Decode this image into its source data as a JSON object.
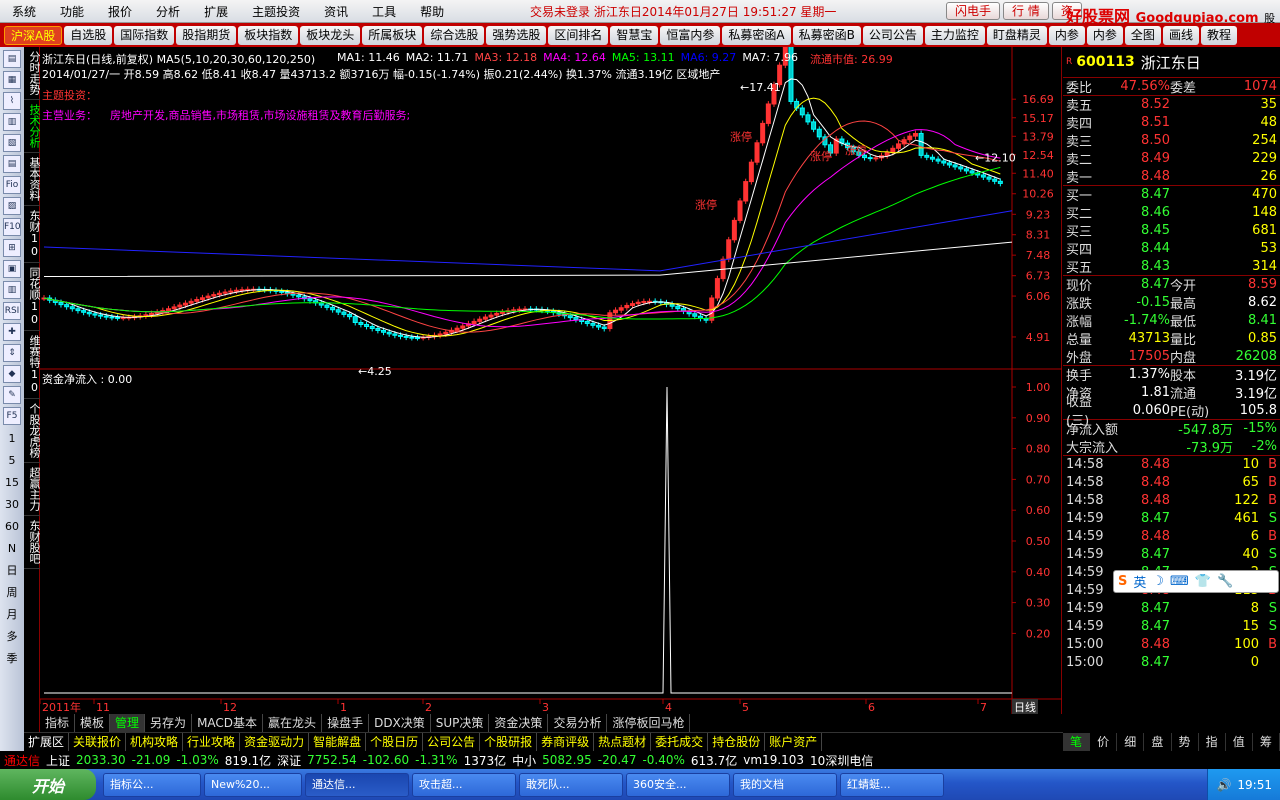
{
  "menu": [
    "系统",
    "功能",
    "报价",
    "分析",
    "扩展",
    "主题投资",
    "资讯",
    "工具",
    "帮助"
  ],
  "menu_center": "交易未登录   浙江东日2014年01月27日  19:51:27  星期一",
  "menu_buttons": [
    "闪电手",
    "行  情",
    "资"
  ],
  "logo": {
    "text": "好股票网",
    "url": "Goodgupiao.com",
    "sub": "股票软件公式"
  },
  "tabs": [
    "沪深A股",
    "自选股",
    "国际指数",
    "股指期货",
    "板块指数",
    "板块龙头",
    "所属板块",
    "综合选股",
    "强势选股",
    "区间排名",
    "智慧宝",
    "恒富内参",
    "私募密函A",
    "私募密函B",
    "公司公告",
    "主力监控",
    "盯盘精灵",
    "内参",
    "内参",
    "全图",
    "画线",
    "教程"
  ],
  "side_tabs": [
    "分时走势",
    "技术分析",
    "基本资料",
    "东财10",
    "同花顺10",
    "维赛特10",
    "个股龙虎榜",
    "超赢主力",
    "东财股吧"
  ],
  "side_nums": [
    "1",
    "5",
    "15",
    "30",
    "60",
    "N",
    "日",
    "周",
    "月",
    "多",
    "季"
  ],
  "chart": {
    "title_line": "浙江东日(日线,前复权) MA5(5,10,20,30,60,120,250)",
    "ma_labels": [
      {
        "t": "MA1: 11.46",
        "c": "#fff"
      },
      {
        "t": "MA2: 11.71",
        "c": "#fff"
      },
      {
        "t": "MA3: 12.18",
        "c": "#f44"
      },
      {
        "t": "MA4: 12.64",
        "c": "#f0f"
      },
      {
        "t": "MA5: 13.11",
        "c": "#0f0"
      },
      {
        "t": "MA6: 9.27",
        "c": "#00f"
      },
      {
        "t": "MA7: 7.96",
        "c": "#fff"
      }
    ],
    "market_cap": "流通市值: 26.99",
    "info_line": "2014/01/27/一 开8.59 高8.62 低8.41 收8.47 量43713.2 额3716万 幅-0.15(-1.74%) 振0.21(2.44%) 换1.37% 流通3.19亿 区域地产",
    "theme_label": "主题投资：",
    "business_label": "主营业务：",
    "business_text": "房地产开发,商品销售,市场租赁,市场设施租赁及教育后勤服务;",
    "price_axis": [
      "16.69",
      "15.17",
      "13.79",
      "12.54",
      "11.40",
      "10.26",
      "9.23",
      "8.31",
      "7.48",
      "6.73",
      "6.06",
      "4.91"
    ],
    "annotations": [
      {
        "t": "17.41"
      },
      {
        "t": "4.25"
      },
      {
        "t": "12.10"
      }
    ],
    "zt_label": "涨停",
    "flow_title": "资金净流入 : 0.00",
    "flow_axis": [
      "1.00",
      "0.90",
      "0.80",
      "0.70",
      "0.60",
      "0.50",
      "0.40",
      "0.30",
      "0.20"
    ],
    "x_labels": [
      "2011年",
      "11",
      "12",
      "1",
      "2",
      "3",
      "4",
      "5",
      "6",
      "7"
    ],
    "period": "日线"
  },
  "chart_data": {
    "type": "candlestick",
    "series": [
      {
        "name": "资金净流入",
        "peak": 1.0,
        "baseline": 0.0
      }
    ],
    "ylim": [
      4.25,
      17.41
    ]
  },
  "ind_tabs": [
    "指标",
    "模板",
    "管理",
    "另存为",
    "MACD基本",
    "赢在龙头",
    "操盘手",
    "DDX决策",
    "SUP决策",
    "资金决策",
    "交易分析",
    "涨停板回马枪"
  ],
  "ext_tabs": [
    "扩展区",
    "关联报价",
    "机构攻略",
    "行业攻略",
    "资金驱动力",
    "智能解盘",
    "个股日历",
    "公司公告",
    "个股研报",
    "券商评级",
    "热点题材",
    "委托成交",
    "持仓股份",
    "账户资产"
  ],
  "quote": {
    "code": "600113",
    "name": "浙江东日",
    "weibi": {
      "l": "委比",
      "v": "47.56%",
      "l2": "委差",
      "v2": "1074"
    },
    "asks": [
      {
        "l": "卖五",
        "p": "8.52",
        "v": "35"
      },
      {
        "l": "卖四",
        "p": "8.51",
        "v": "48"
      },
      {
        "l": "卖三",
        "p": "8.50",
        "v": "254"
      },
      {
        "l": "卖二",
        "p": "8.49",
        "v": "229"
      },
      {
        "l": "卖一",
        "p": "8.48",
        "v": "26"
      }
    ],
    "bids": [
      {
        "l": "买一",
        "p": "8.47",
        "v": "470"
      },
      {
        "l": "买二",
        "p": "8.46",
        "v": "148"
      },
      {
        "l": "买三",
        "p": "8.45",
        "v": "681"
      },
      {
        "l": "买四",
        "p": "8.44",
        "v": "53"
      },
      {
        "l": "买五",
        "p": "8.43",
        "v": "314"
      }
    ],
    "stats": [
      {
        "a": "现价",
        "b": "8.47",
        "c": "今开",
        "d": "8.59",
        "bc": "green",
        "dc": "red"
      },
      {
        "a": "涨跌",
        "b": "-0.15",
        "c": "最高",
        "d": "8.62",
        "bc": "green",
        "dc": "white"
      },
      {
        "a": "涨幅",
        "b": "-1.74%",
        "c": "最低",
        "d": "8.41",
        "bc": "green",
        "dc": "green"
      },
      {
        "a": "总量",
        "b": "43713",
        "c": "量比",
        "d": "0.85",
        "bc": "yellow",
        "dc": "yellow"
      },
      {
        "a": "外盘",
        "b": "17505",
        "c": "内盘",
        "d": "26208",
        "bc": "red",
        "dc": "green"
      },
      {
        "a": "换手",
        "b": "1.37%",
        "c": "股本",
        "d": "3.19亿",
        "bc": "white",
        "dc": "white"
      },
      {
        "a": "净资",
        "b": "1.81",
        "c": "流通",
        "d": "3.19亿",
        "bc": "white",
        "dc": "white"
      },
      {
        "a": "收益(三)",
        "b": "0.060",
        "c": "PE(动)",
        "d": "105.8",
        "bc": "white",
        "dc": "white"
      }
    ],
    "flows": [
      {
        "a": "净流入额",
        "b": "-547.8万",
        "c": "-15%"
      },
      {
        "a": "大宗流入",
        "b": "-73.9万",
        "c": "-2%"
      }
    ],
    "ticks": [
      {
        "t": "14:58",
        "p": "8.48",
        "v": "10",
        "s": "B"
      },
      {
        "t": "14:58",
        "p": "8.48",
        "v": "65",
        "s": "B"
      },
      {
        "t": "14:58",
        "p": "8.48",
        "v": "122",
        "s": "B"
      },
      {
        "t": "14:59",
        "p": "8.47",
        "v": "461",
        "s": "S"
      },
      {
        "t": "14:59",
        "p": "8.48",
        "v": "6",
        "s": "B"
      },
      {
        "t": "14:59",
        "p": "8.47",
        "v": "40",
        "s": "S"
      },
      {
        "t": "14:59",
        "p": "8.47",
        "v": "2",
        "s": "S"
      },
      {
        "t": "14:59",
        "p": "8.48",
        "v": "115",
        "s": "B"
      },
      {
        "t": "14:59",
        "p": "8.47",
        "v": "8",
        "s": "S"
      },
      {
        "t": "14:59",
        "p": "8.47",
        "v": "15",
        "s": "S"
      },
      {
        "t": "15:00",
        "p": "8.48",
        "v": "100",
        "s": "B"
      },
      {
        "t": "15:00",
        "p": "8.47",
        "v": "0",
        "s": ""
      }
    ],
    "tabs": [
      "笔",
      "价",
      "细",
      "盘",
      "势",
      "指",
      "值",
      "筹"
    ]
  },
  "status": [
    {
      "t": "通达信",
      "c": "#f00"
    },
    {
      "t": "上证",
      "c": "#fff"
    },
    {
      "t": "2033.30",
      "c": "#3f3"
    },
    {
      "t": "-21.09",
      "c": "#3f3"
    },
    {
      "t": "-1.03%",
      "c": "#3f3"
    },
    {
      "t": "819.1亿",
      "c": "#fff"
    },
    {
      "t": "深证",
      "c": "#fff"
    },
    {
      "t": "7752.54",
      "c": "#3f3"
    },
    {
      "t": "-102.60",
      "c": "#3f3"
    },
    {
      "t": "-1.31%",
      "c": "#3f3"
    },
    {
      "t": "1373亿",
      "c": "#fff"
    },
    {
      "t": "中小",
      "c": "#fff"
    },
    {
      "t": "5082.95",
      "c": "#3f3"
    },
    {
      "t": "-20.47",
      "c": "#3f3"
    },
    {
      "t": "-0.40%",
      "c": "#3f3"
    },
    {
      "t": "613.7亿",
      "c": "#fff"
    },
    {
      "t": "vm19.103",
      "c": "#fff"
    },
    {
      "t": "10深圳电信",
      "c": "#fff"
    }
  ],
  "taskbar": {
    "start": "开始",
    "items": [
      "指标公...",
      "New%20...",
      "通达信...",
      "攻击超...",
      "敢死队...",
      "360安全...",
      "我的文档",
      "红蜻蜓..."
    ],
    "clock": "19:51"
  },
  "ime": "英"
}
